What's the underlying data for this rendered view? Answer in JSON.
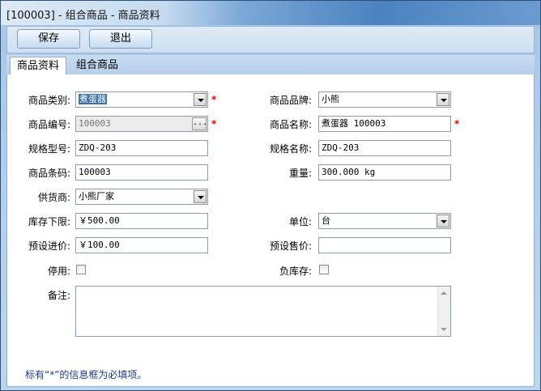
{
  "window": {
    "title": "[100003] - 组合商品 - 商品资料"
  },
  "toolbar": {
    "save_label": "保存",
    "exit_label": "退出"
  },
  "tabs": [
    {
      "label": "商品资料",
      "active": true
    },
    {
      "label": "组合商品",
      "active": false
    }
  ],
  "form": {
    "category": {
      "label": "商品类别:",
      "value": "煮蛋器",
      "required": true
    },
    "brand": {
      "label": "商品品牌:",
      "value": "小熊"
    },
    "code": {
      "label": "商品编号:",
      "value": "100003",
      "required": true,
      "button": "..."
    },
    "name": {
      "label": "商品名称:",
      "value": "煮蛋器 100003",
      "required": true
    },
    "spec_model": {
      "label": "规格型号:",
      "value": "ZDQ-203"
    },
    "spec_name": {
      "label": "规格名称:",
      "value": "ZDQ-203"
    },
    "barcode": {
      "label": "商品条码:",
      "value": "100003"
    },
    "weight": {
      "label": "重量:",
      "value": "300.000 kg"
    },
    "supplier": {
      "label": "供货商:",
      "value": "小熊厂家"
    },
    "stock_min": {
      "label": "库存下限:",
      "value": "￥500.00"
    },
    "unit": {
      "label": "单位:",
      "value": "台"
    },
    "purchase_price": {
      "label": "预设进价:",
      "value": "￥100.00"
    },
    "sale_price": {
      "label": "预设售价:",
      "value": ""
    },
    "disabled": {
      "label": "停用:",
      "checked": false
    },
    "negative_stock": {
      "label": "负库存:",
      "checked": false
    },
    "remark": {
      "label": "备注:",
      "value": ""
    }
  },
  "required_mark": "*",
  "footer_note": "标有“*”的信息框为必填项。"
}
